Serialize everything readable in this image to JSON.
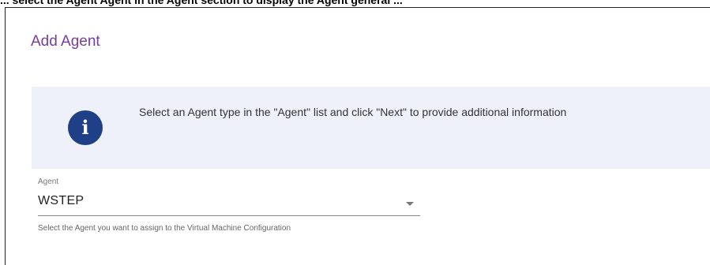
{
  "dialog": {
    "title": "Add Agent",
    "partial_caption": "... select the Agent Agent in the Agent section to display the Agent general ..."
  },
  "info": {
    "icon": "info-icon",
    "icon_glyph": "i",
    "message": "Select an Agent type in the \"Agent\" list and click \"Next\" to provide additional information"
  },
  "agent_field": {
    "label": "Agent",
    "value": "WSTEP",
    "helper": "Select the Agent you want to assign to the Virtual Machine Configuration"
  },
  "colors": {
    "title": "#7b3c98",
    "info_background": "#eef1fa",
    "info_icon": "#1f3f86"
  }
}
